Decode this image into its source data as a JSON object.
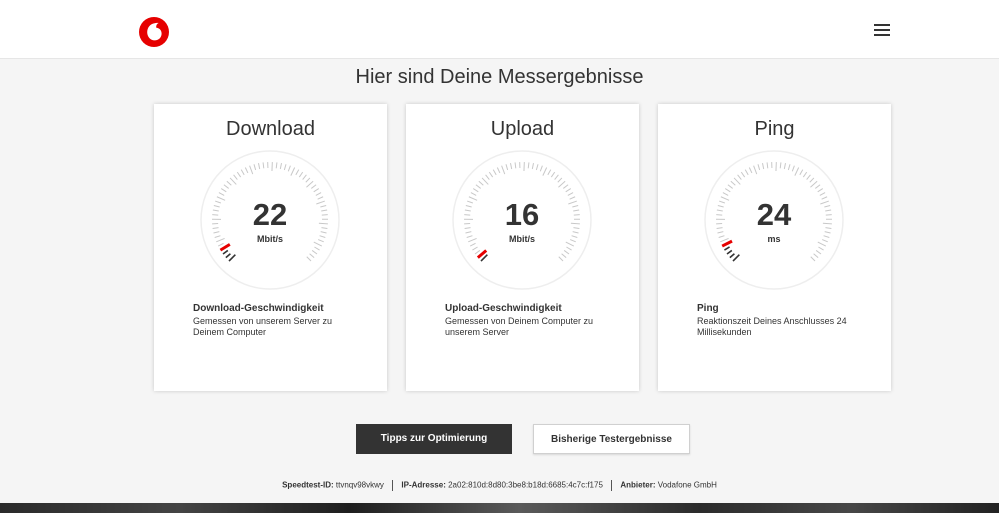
{
  "header": {
    "logo_icon": "vodafone-logo",
    "menu_icon": "hamburger-menu-icon",
    "brand_color": "#e60000"
  },
  "page_title": "Hier sind Deine Messergebnisse",
  "cards": [
    {
      "title": "Download",
      "value": "22",
      "unit": "Mbit/s",
      "gauge_level": 0.05,
      "desc_heading": "Download-Geschwindigkeit",
      "desc_text": "Gemessen von unserem Server zu Deinem Computer"
    },
    {
      "title": "Upload",
      "value": "16",
      "unit": "Mbit/s",
      "gauge_level": 0.02,
      "desc_heading": "Upload-Geschwindigkeit",
      "desc_text": "Gemessen von Deinem Computer zu unserem Server"
    },
    {
      "title": "Ping",
      "value": "24",
      "unit": "ms",
      "gauge_level": 0.07,
      "desc_heading": "Ping",
      "desc_text": "Reaktionszeit Deines Anschlusses 24 Millisekunden"
    }
  ],
  "buttons": {
    "tips_label": "Tipps zur Optimierung",
    "history_label": "Bisherige Testergebnisse"
  },
  "info": {
    "speedtest_id_label": "Speedtest-ID:",
    "speedtest_id_value": "ttvnqv98vkwy",
    "ip_label": "IP-Adresse:",
    "ip_value": "2a02:810d:8d80:3be8:b18d:6685:4c7c:f175",
    "provider_label": "Anbieter:",
    "provider_value": "Vodafone GmbH"
  },
  "colors": {
    "accent": "#e60000",
    "tick_active": "#333333",
    "tick_inactive": "#c8c8c8",
    "button_dark": "#333333"
  }
}
